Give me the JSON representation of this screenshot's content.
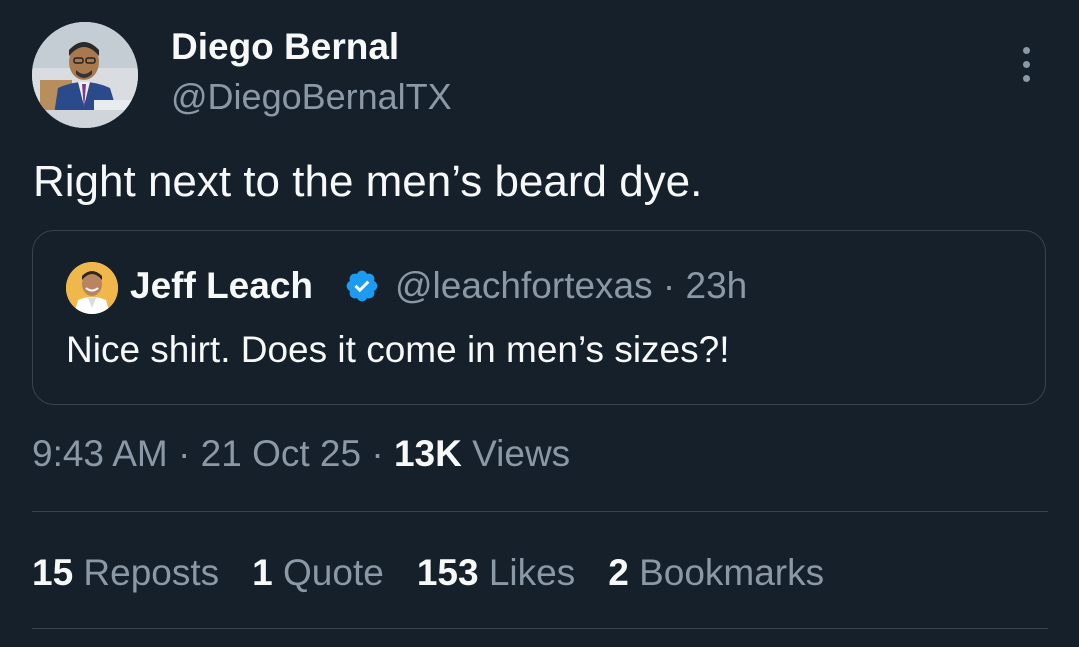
{
  "tweet": {
    "author": {
      "name": "Diego Bernal",
      "handle": "@DiegoBernalTX",
      "avatar_icon": "profile-photo"
    },
    "text": "Right next to the men’s beard dye.",
    "quote": {
      "author_name": "Jeff Leach",
      "verified": true,
      "verified_color": "#1d9bf0",
      "handle_time": "@leachfortexas · 23h",
      "text": "Nice shirt. Does it come in men’s sizes?!"
    },
    "meta": {
      "time": "9:43 AM",
      "sep1": " · ",
      "date": "21 Oct 25",
      "sep2": " · ",
      "views_count": "13K",
      "views_label": " Views"
    },
    "stats": [
      {
        "count": "15",
        "label": " Reposts"
      },
      {
        "count": "1",
        "label": " Quote"
      },
      {
        "count": "153",
        "label": " Likes"
      },
      {
        "count": "2",
        "label": " Bookmarks"
      }
    ]
  },
  "colors": {
    "background": "#15202b",
    "text_primary": "#f7f9f9",
    "text_secondary": "#8b98a5",
    "border": "#38444d",
    "accent": "#1d9bf0"
  }
}
